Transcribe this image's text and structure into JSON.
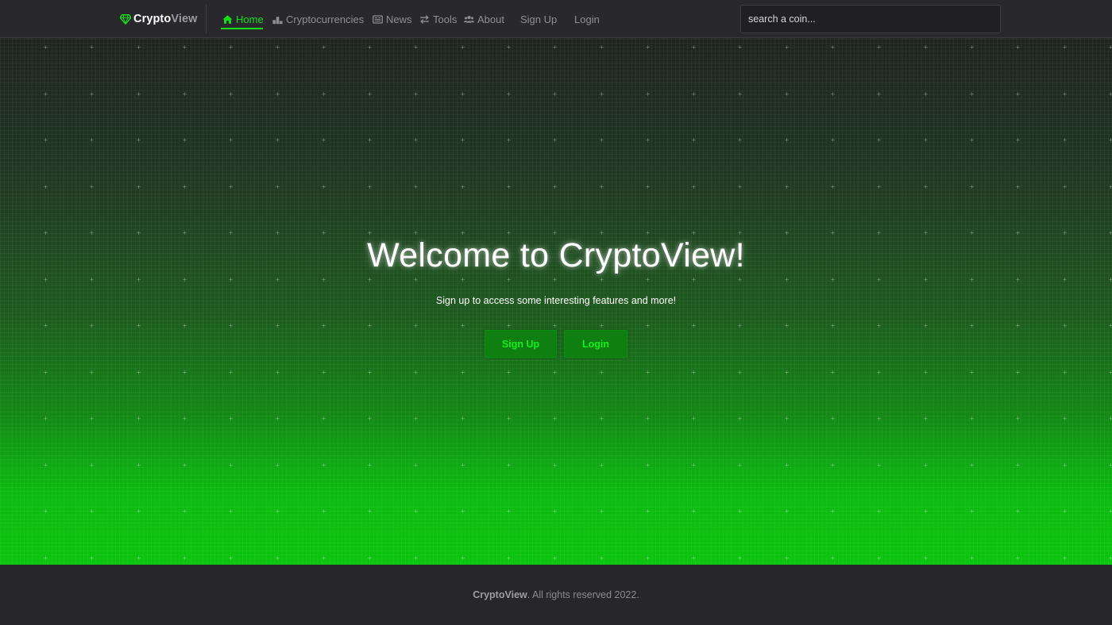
{
  "brand": {
    "name_part1": "Crypto",
    "name_part2": "View",
    "icon": "diamond-icon",
    "accent": "#14e01a"
  },
  "nav": {
    "items": [
      {
        "label": "Home",
        "icon": "home-icon",
        "active": true
      },
      {
        "label": "Cryptocurrencies",
        "icon": "chart-bars-icon"
      },
      {
        "label": "News",
        "icon": "newspaper-icon"
      },
      {
        "label": "Tools",
        "icon": "exchange-icon"
      },
      {
        "label": "About",
        "icon": "users-icon"
      },
      {
        "label": "Sign Up"
      },
      {
        "label": "Login"
      }
    ]
  },
  "search": {
    "placeholder": "search a coin..."
  },
  "hero": {
    "title": "Welcome to CryptoView!",
    "subtitle": "Sign up to access some interesting features and more!",
    "signup_label": "Sign Up",
    "login_label": "Login"
  },
  "footer": {
    "brand": "CryptoView",
    "text": ". All rights reserved 2022."
  }
}
